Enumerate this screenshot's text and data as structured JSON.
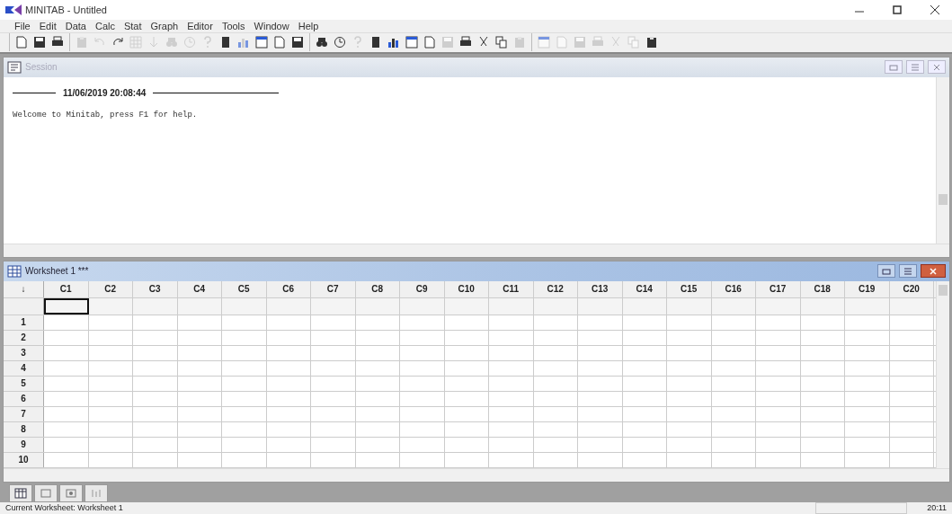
{
  "window": {
    "title": "MINITAB - Untitled"
  },
  "menu": [
    {
      "label": "File"
    },
    {
      "label": "Edit"
    },
    {
      "label": "Data"
    },
    {
      "label": "Calc"
    },
    {
      "label": "Stat"
    },
    {
      "label": "Graph"
    },
    {
      "label": "Editor"
    },
    {
      "label": "Tools"
    },
    {
      "label": "Window"
    },
    {
      "label": "Help"
    }
  ],
  "toolbar": [
    [
      {
        "disabled": false
      },
      {
        "disabled": false
      },
      {
        "disabled": false
      }
    ],
    [
      {
        "disabled": true
      },
      {
        "disabled": true
      },
      {
        "disabled": false
      },
      {
        "disabled": true
      },
      {
        "disabled": true
      },
      {
        "disabled": true
      },
      {
        "disabled": true
      },
      {
        "disabled": true
      },
      {
        "disabled": false
      },
      {
        "disabled": true
      },
      {
        "disabled": false
      },
      {
        "disabled": false
      },
      {
        "disabled": false
      }
    ],
    [
      {
        "disabled": false
      },
      {
        "disabled": false
      },
      {
        "disabled": true
      },
      {
        "disabled": false
      },
      {
        "disabled": false
      },
      {
        "disabled": false
      },
      {
        "disabled": false
      },
      {
        "disabled": true
      },
      {
        "disabled": false
      },
      {
        "disabled": false
      },
      {
        "disabled": false
      },
      {
        "disabled": true
      }
    ],
    [
      {
        "disabled": true
      },
      {
        "disabled": true
      },
      {
        "disabled": true
      },
      {
        "disabled": true
      },
      {
        "disabled": true
      },
      {
        "disabled": true
      },
      {
        "disabled": false
      }
    ]
  ],
  "session": {
    "title": "Session",
    "timestamp": "11/06/2019 20:08:44",
    "message": "Welcome to Minitab, press F1 for help."
  },
  "worksheet": {
    "title": "Worksheet 1 ***",
    "corner": "↓",
    "columns": [
      "C1",
      "C2",
      "C3",
      "C4",
      "C5",
      "C6",
      "C7",
      "C8",
      "C9",
      "C10",
      "C11",
      "C12",
      "C13",
      "C14",
      "C15",
      "C16",
      "C17",
      "C18",
      "C19",
      "C20"
    ],
    "name_cells": [
      {
        "selected": true
      },
      {
        "selected": false
      },
      {
        "selected": false
      },
      {
        "selected": false
      },
      {
        "selected": false
      },
      {
        "selected": false
      },
      {
        "selected": false
      },
      {
        "selected": false
      },
      {
        "selected": false
      },
      {
        "selected": false
      },
      {
        "selected": false
      },
      {
        "selected": false
      },
      {
        "selected": false
      },
      {
        "selected": false
      },
      {
        "selected": false
      },
      {
        "selected": false
      },
      {
        "selected": false
      },
      {
        "selected": false
      },
      {
        "selected": false
      },
      {
        "selected": false
      }
    ],
    "rows": [
      "1",
      "2",
      "3",
      "4",
      "5",
      "6",
      "7",
      "8",
      "9",
      "10"
    ]
  },
  "status_bar": {
    "message": "Current Worksheet: Worksheet 1",
    "time": "20:11"
  }
}
